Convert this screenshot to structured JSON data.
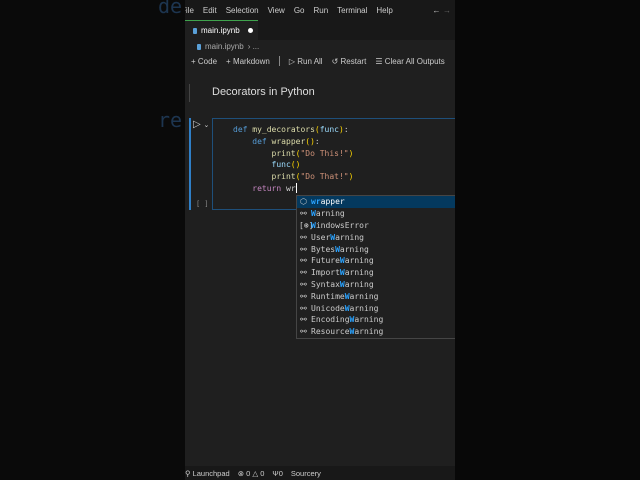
{
  "menu": [
    "File",
    "Edit",
    "Selection",
    "View",
    "Go",
    "Run",
    "Terminal",
    "Help"
  ],
  "tab": {
    "label": "main.ipynb"
  },
  "breadcrumb": {
    "file": "main.ipynb",
    "rest": "› ..."
  },
  "toolbar": {
    "code": "Code",
    "markdown": "Markdown",
    "run_all": "Run All",
    "restart": "Restart",
    "clear": "Clear All Outputs"
  },
  "markdown_cell": "Decorators in Python",
  "code_cell": {
    "exec_count": "[ ]"
  },
  "suggestions": [
    {
      "label": "wrapper",
      "match": "wr",
      "rest": "apper",
      "pre": "",
      "kind": "function"
    },
    {
      "label": "Warning",
      "pre": "",
      "match": "W",
      "rest": "arning",
      "kind": "class"
    },
    {
      "label": "WindowsError",
      "pre": "",
      "match": "W",
      "rest": "indowsError",
      "kind": "variable"
    },
    {
      "label": "UserWarning",
      "pre": "User",
      "match": "W",
      "rest": "arning",
      "kind": "class"
    },
    {
      "label": "BytesWarning",
      "pre": "Bytes",
      "match": "W",
      "rest": "arning",
      "kind": "class"
    },
    {
      "label": "FutureWarning",
      "pre": "Future",
      "match": "W",
      "rest": "arning",
      "kind": "class"
    },
    {
      "label": "ImportWarning",
      "pre": "Import",
      "match": "W",
      "rest": "arning",
      "kind": "class"
    },
    {
      "label": "SyntaxWarning",
      "pre": "Syntax",
      "match": "W",
      "rest": "arning",
      "kind": "class"
    },
    {
      "label": "RuntimeWarning",
      "pre": "Runtime",
      "match": "W",
      "rest": "arning",
      "kind": "class"
    },
    {
      "label": "UnicodeWarning",
      "pre": "Unicode",
      "match": "W",
      "rest": "arning",
      "kind": "class"
    },
    {
      "label": "EncodingWarning",
      "pre": "Encoding",
      "match": "W",
      "rest": "arning",
      "kind": "class"
    },
    {
      "label": "ResourceWarning",
      "pre": "Resource",
      "match": "W",
      "rest": "arning",
      "kind": "class"
    }
  ],
  "status": {
    "launchpad": "Launchpad",
    "errors": "0",
    "warnings": "0",
    "ports": "0",
    "sourcery": "Sourcery"
  },
  "colors": {
    "accent": "#2f7fc7",
    "tab_active": "#3fa34d",
    "selection": "#04395e",
    "match": "#2aa3ff"
  }
}
